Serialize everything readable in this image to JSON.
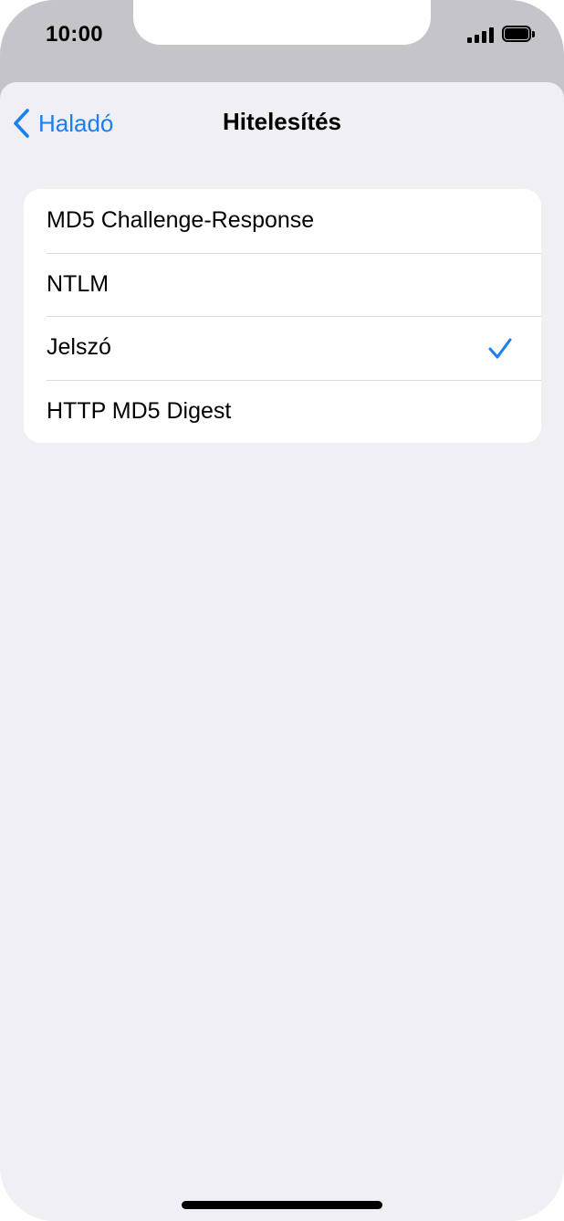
{
  "status_bar": {
    "time": "10:00"
  },
  "nav": {
    "back_label": "Haladó",
    "title": "Hitelesítés"
  },
  "options": [
    {
      "label": "MD5 Challenge-Response",
      "selected": false
    },
    {
      "label": "NTLM",
      "selected": false
    },
    {
      "label": "Jelszó",
      "selected": true
    },
    {
      "label": "HTTP MD5 Digest",
      "selected": false
    }
  ],
  "colors": {
    "accent": "#1a7ff0",
    "background": "#efeff4",
    "top_frame": "#c5c5c9"
  },
  "icons": {
    "back": "chevron-left-icon",
    "selected": "checkmark-icon",
    "signal": "cellular-signal-icon",
    "battery": "battery-icon"
  }
}
